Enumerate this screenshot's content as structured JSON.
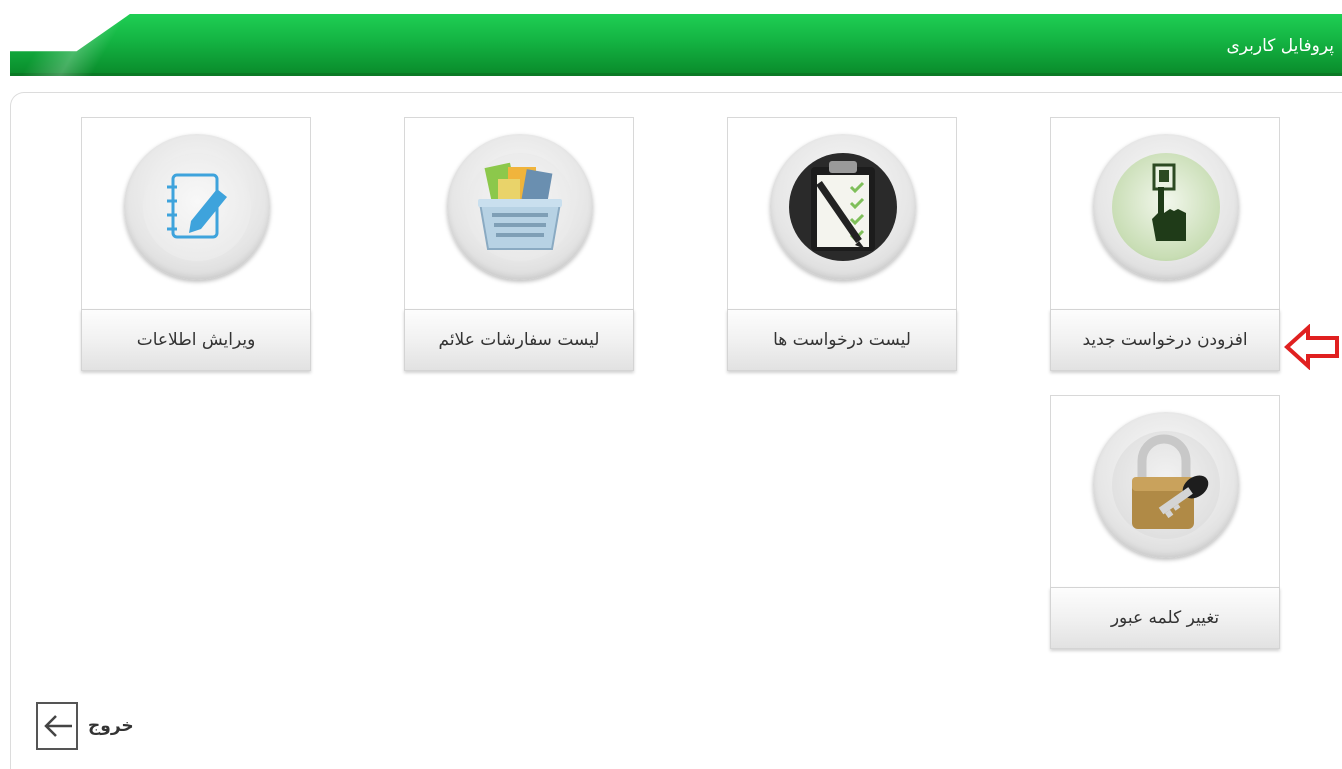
{
  "header": {
    "title": "پروفایل کاربری",
    "color": "#14b443"
  },
  "tiles": [
    {
      "label": "افزودن درخواست جدید",
      "icon": "hand-press-button-icon"
    },
    {
      "label": "لیست درخواست ها",
      "icon": "clipboard-checklist-icon"
    },
    {
      "label": "لیست سفارشات علائم",
      "icon": "shopping-basket-icon"
    },
    {
      "label": "ویرایش اطلاعات",
      "icon": "edit-notebook-icon"
    },
    {
      "label": "تغییر کلمه عبور",
      "icon": "padlock-key-icon"
    }
  ],
  "logout": {
    "label": "خروج",
    "icon": "logout-arrow-icon"
  },
  "indicator": {
    "icon": "red-arrow-left-icon",
    "color": "#e02020"
  }
}
